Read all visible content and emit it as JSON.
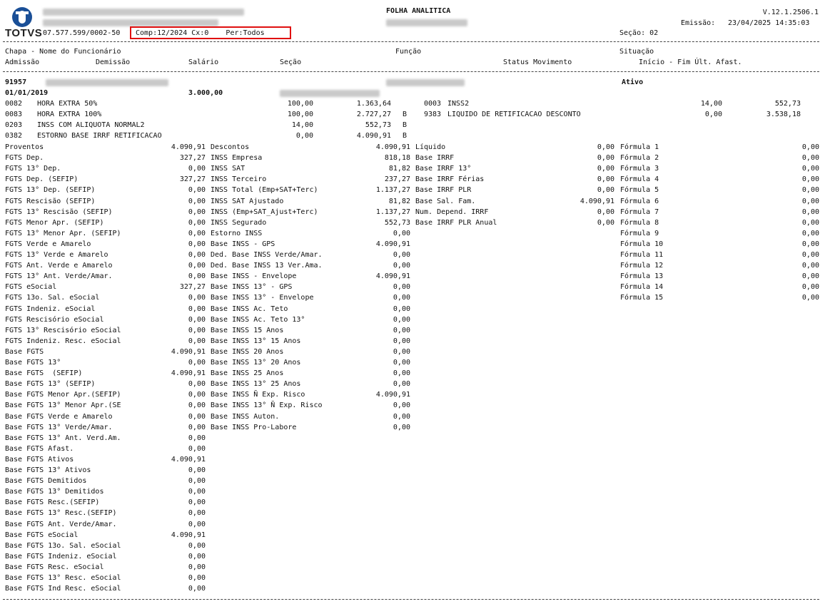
{
  "header": {
    "brand": "TOTVS",
    "cnpj": "07.577.599/0002-50",
    "filter": "Comp:12/2024 Cx:0    Per:Todos",
    "report_title": "FOLHA ANALITICA",
    "version": "V.12.1.2506.1",
    "emissao_label": "Emissão:",
    "emissao_value": "23/04/2025 14:35:03",
    "secao": "Seção: 02"
  },
  "columns": {
    "row1": {
      "chapa": "Chapa - Nome do Funcionário",
      "funcao": "Função",
      "situacao": "Situação"
    },
    "row2": {
      "admissao": "Admissão",
      "demissao": "Demissão",
      "salario": "Salário",
      "secao": "Seção",
      "status": "Status Movimento",
      "inicio": "Início - Fim Últ. Afast."
    }
  },
  "employee": {
    "chapa": "91957",
    "status": "Ativo",
    "admissao": "01/01/2019",
    "salario": "3.000,00"
  },
  "events_left": [
    {
      "code": "0082",
      "desc": "HORA EXTRA 50%",
      "ref": "100,00",
      "value": "1.363,64",
      "flag": ""
    },
    {
      "code": "0083",
      "desc": "HORA EXTRA 100%",
      "ref": "100,00",
      "value": "2.727,27",
      "flag": "B"
    },
    {
      "code": "0203",
      "desc": "INSS COM ALIQUOTA NORMAL2",
      "ref": "14,00",
      "value": "552,73",
      "flag": "B"
    },
    {
      "code": "0382",
      "desc": "ESTORNO BASE IRRF RETIFICACAO",
      "ref": "0,00",
      "value": "4.090,91",
      "flag": "B"
    }
  ],
  "events_right": [
    {
      "code": "0003",
      "desc": "INSS2",
      "ref": "14,00",
      "value": "552,73"
    },
    {
      "code": "9383",
      "desc": "LIQUIDO DE RETIFICACAO DESCONTO",
      "ref": "0,00",
      "value": "3.538,18"
    }
  ],
  "col1": [
    [
      "Proventos",
      "4.090,91"
    ],
    [
      "FGTS Dep.",
      "327,27"
    ],
    [
      "FGTS 13° Dep.",
      "0,00"
    ],
    [
      "FGTS Dep. (SEFIP)",
      "327,27"
    ],
    [
      "FGTS 13° Dep. (SEFIP)",
      "0,00"
    ],
    [
      "FGTS Rescisão (SEFIP)",
      "0,00"
    ],
    [
      "FGTS 13° Rescisão (SEFIP)",
      "0,00"
    ],
    [
      "FGTS Menor Apr. (SEFIP)",
      "0,00"
    ],
    [
      "FGTS 13° Menor Apr. (SEFIP)",
      "0,00"
    ],
    [
      "FGTS Verde e Amarelo",
      "0,00"
    ],
    [
      "FGTS 13° Verde e Amarelo",
      "0,00"
    ],
    [
      "FGTS Ant. Verde e Amarelo",
      "0,00"
    ],
    [
      "FGTS 13° Ant. Verde/Amar.",
      "0,00"
    ],
    [
      "FGTS eSocial",
      "327,27"
    ],
    [
      "FGTS 13o. Sal. eSocial",
      "0,00"
    ],
    [
      "FGTS Indeniz. eSocial",
      "0,00"
    ],
    [
      "FGTS Rescisório eSocial",
      "0,00"
    ],
    [
      "FGTS 13° Rescisório eSocial",
      "0,00"
    ],
    [
      "FGTS Indeniz. Resc. eSocial",
      "0,00"
    ],
    [
      "Base FGTS",
      "4.090,91"
    ],
    [
      "Base FGTS 13°",
      "0,00"
    ],
    [
      "Base FGTS  (SEFIP)",
      "4.090,91"
    ],
    [
      "Base FGTS 13° (SEFIP)",
      "0,00"
    ],
    [
      "Base FGTS Menor Apr.(SEFIP)",
      "0,00"
    ],
    [
      "Base FGTS 13° Menor Apr.(SE",
      "0,00"
    ],
    [
      "Base FGTS Verde e Amarelo",
      "0,00"
    ],
    [
      "Base FGTS 13° Verde/Amar.",
      "0,00"
    ],
    [
      "Base FGTS 13° Ant. Verd.Am.",
      "0,00"
    ],
    [
      "Base FGTS Afast.",
      "0,00"
    ],
    [
      "Base FGTS Ativos",
      "4.090,91"
    ],
    [
      "Base FGTS 13° Ativos",
      "0,00"
    ],
    [
      "Base FGTS Demitidos",
      "0,00"
    ],
    [
      "Base FGTS 13° Demitidos",
      "0,00"
    ],
    [
      "Base FGTS Resc.(SEFIP)",
      "0,00"
    ],
    [
      "Base FGTS 13° Resc.(SEFIP)",
      "0,00"
    ],
    [
      "Base FGTS Ant. Verde/Amar.",
      "0,00"
    ],
    [
      "Base FGTS eSocial",
      "4.090,91"
    ],
    [
      "Base FGTS 13o. Sal. eSocial",
      "0,00"
    ],
    [
      "Base FGTS Indeniz. eSocial",
      "0,00"
    ],
    [
      "Base FGTS Resc. eSocial",
      "0,00"
    ],
    [
      "Base FGTS 13° Resc. eSocial",
      "0,00"
    ],
    [
      "Base FGTS Ind Resc. eSocial",
      "0,00"
    ]
  ],
  "col2": [
    [
      "Descontos",
      "4.090,91"
    ],
    [
      "INSS Empresa",
      "818,18"
    ],
    [
      "INSS SAT",
      "81,82"
    ],
    [
      "INSS Terceiro",
      "237,27"
    ],
    [
      "INSS Total (Emp+SAT+Terc)",
      "1.137,27"
    ],
    [
      "INSS SAT Ajustado",
      "81,82"
    ],
    [
      "INSS (Emp+SAT_Ajust+Terc)",
      "1.137,27"
    ],
    [
      "INSS Segurado",
      "552,73"
    ],
    [
      "Estorno INSS",
      "0,00"
    ],
    [
      "Base INSS - GPS",
      "4.090,91"
    ],
    [
      "Ded. Base INSS Verde/Amar.",
      "0,00"
    ],
    [
      "Ded. Base INSS 13 Ver.Ama.",
      "0,00"
    ],
    [
      "Base INSS - Envelope",
      "4.090,91"
    ],
    [
      "Base INSS 13° - GPS",
      "0,00"
    ],
    [
      "Base INSS 13° - Envelope",
      "0,00"
    ],
    [
      "Base INSS Ac. Teto",
      "0,00"
    ],
    [
      "Base INSS Ac. Teto 13°",
      "0,00"
    ],
    [
      "Base INSS 15 Anos",
      "0,00"
    ],
    [
      "Base INSS 13° 15 Anos",
      "0,00"
    ],
    [
      "Base INSS 20 Anos",
      "0,00"
    ],
    [
      "Base INSS 13° 20 Anos",
      "0,00"
    ],
    [
      "Base INSS 25 Anos",
      "0,00"
    ],
    [
      "Base INSS 13° 25 Anos",
      "0,00"
    ],
    [
      "Base INSS Ñ Exp. Risco",
      "4.090,91"
    ],
    [
      "Base INSS 13° Ñ Exp. Risco",
      "0,00"
    ],
    [
      "Base INSS Auton.",
      "0,00"
    ],
    [
      "Base INSS Pro-Labore",
      "0,00"
    ]
  ],
  "col3": [
    [
      "Líquido",
      "0,00"
    ],
    [
      "Base IRRF",
      "0,00"
    ],
    [
      "Base IRRF 13°",
      "0,00"
    ],
    [
      "Base IRRF Férias",
      "0,00"
    ],
    [
      "Base IRRF PLR",
      "0,00"
    ],
    [
      "Base Sal. Fam.",
      "4.090,91"
    ],
    [
      "Num. Depend. IRRF",
      "0,00"
    ],
    [
      "Base IRRF PLR Anual",
      "0,00"
    ]
  ],
  "col4": [
    [
      "Fórmula 1",
      "0,00"
    ],
    [
      "Fórmula 2",
      "0,00"
    ],
    [
      "Fórmula 3",
      "0,00"
    ],
    [
      "Fórmula 4",
      "0,00"
    ],
    [
      "Fórmula 5",
      "0,00"
    ],
    [
      "Fórmula 6",
      "0,00"
    ],
    [
      "Fórmula 7",
      "0,00"
    ],
    [
      "Fórmula 8",
      "0,00"
    ],
    [
      "Fórmula 9",
      "0,00"
    ],
    [
      "Fórmula 10",
      "0,00"
    ],
    [
      "Fórmula 11",
      "0,00"
    ],
    [
      "Fórmula 12",
      "0,00"
    ],
    [
      "Fórmula 13",
      "0,00"
    ],
    [
      "Fórmula 14",
      "0,00"
    ],
    [
      "Fórmula 15",
      "0,00"
    ]
  ]
}
